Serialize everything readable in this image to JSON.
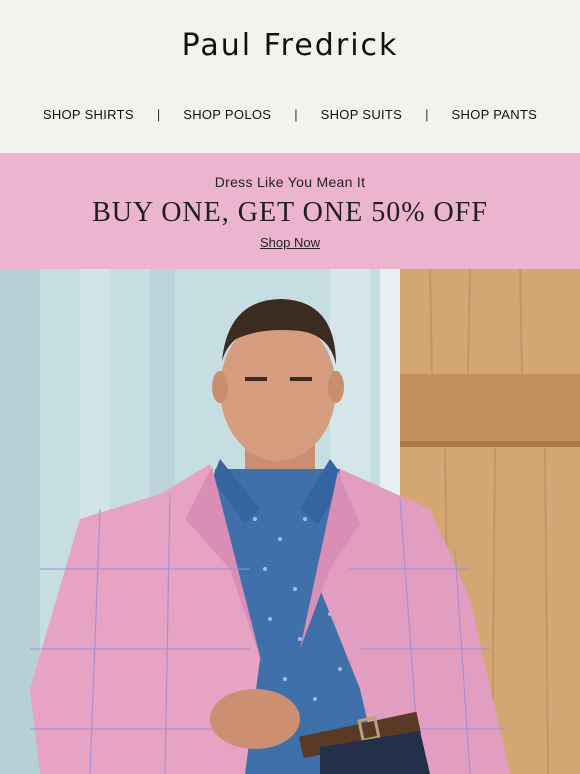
{
  "brand": {
    "name": "Paul Fredrick"
  },
  "nav": {
    "items": [
      {
        "label": "SHOP SHIRTS"
      },
      {
        "label": "SHOP POLOS"
      },
      {
        "label": "SHOP SUITS"
      },
      {
        "label": "SHOP PANTS"
      }
    ],
    "separator": "|"
  },
  "promo": {
    "eyebrow": "Dress Like You Mean It",
    "headline": "BUY ONE, GET ONE 50% OFF",
    "cta": "Shop Now"
  },
  "colors": {
    "header_bg": "#f4f2ee",
    "promo_bg": "#ecb4cf",
    "text": "#111111"
  }
}
